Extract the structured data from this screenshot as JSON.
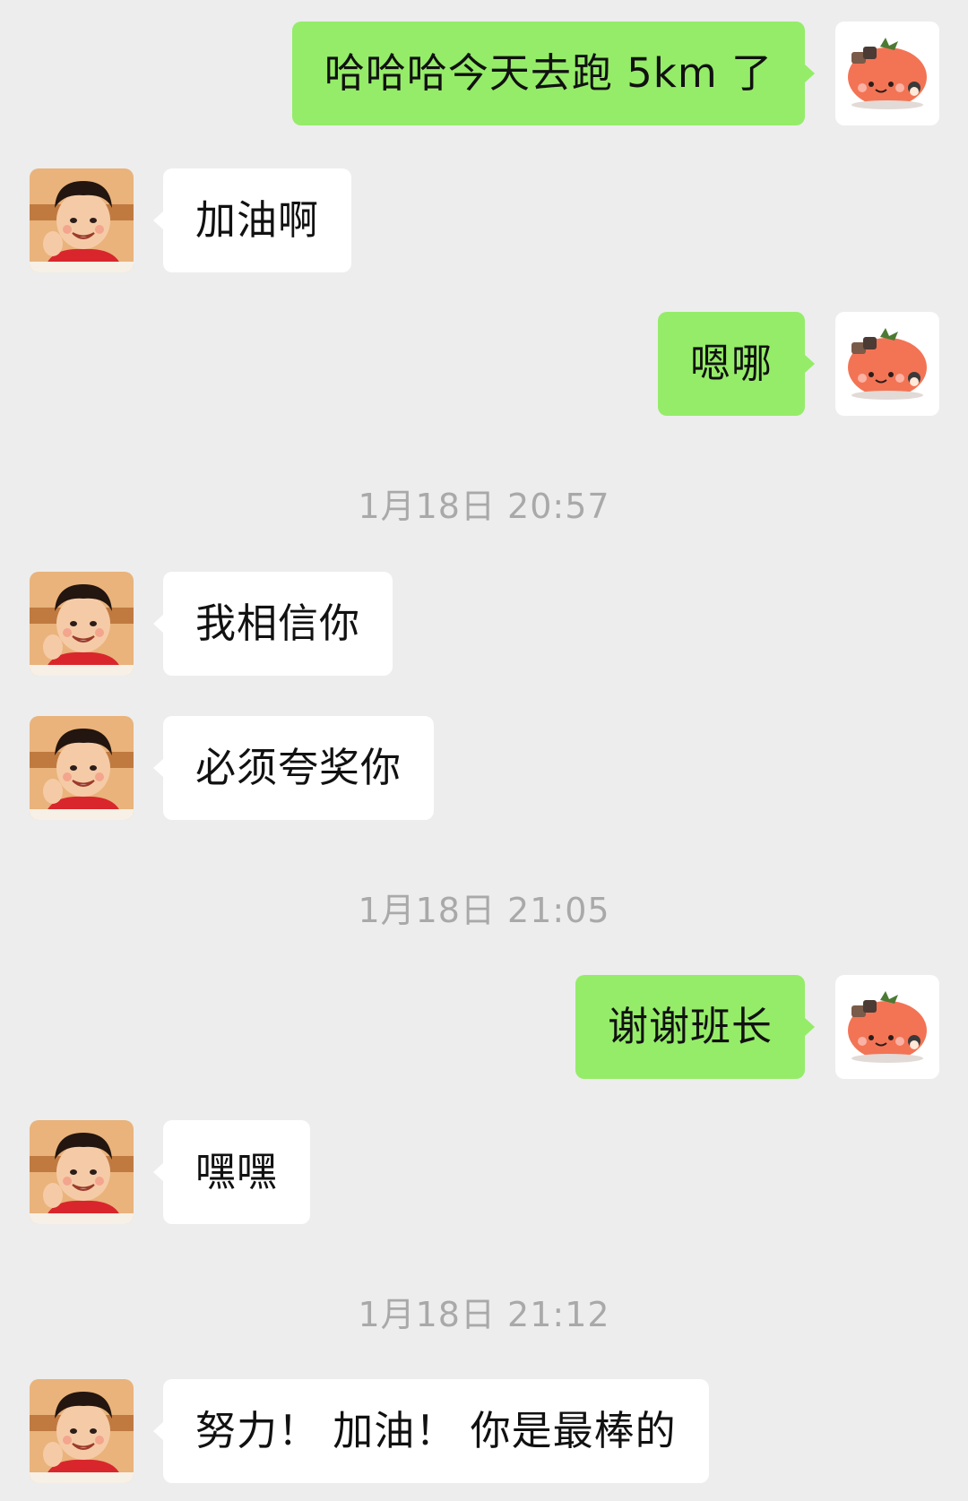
{
  "colors": {
    "background": "#ededed",
    "sent_bubble": "#95ec69",
    "received_bubble": "#ffffff",
    "timestamp_text": "#a9a9a9"
  },
  "icons": {
    "own_avatar": "tomato-avatar-icon",
    "contact_avatar": "child-photo-avatar"
  },
  "messages": [
    {
      "side": "right",
      "text": "哈哈哈今天去跑 5km 了"
    },
    {
      "side": "left",
      "text": "加油啊"
    },
    {
      "side": "right",
      "text": "嗯哪"
    },
    {
      "side": "left",
      "text": "我相信你"
    },
    {
      "side": "left",
      "text": "必须夸奖你"
    },
    {
      "side": "right",
      "text": "谢谢班长"
    },
    {
      "side": "left",
      "text": "嘿嘿"
    },
    {
      "side": "left",
      "text": "努力！ 加油！ 你是最棒的"
    }
  ],
  "timestamps": [
    "1月18日 20:57",
    "1月18日 21:05",
    "1月18日 21:12"
  ]
}
